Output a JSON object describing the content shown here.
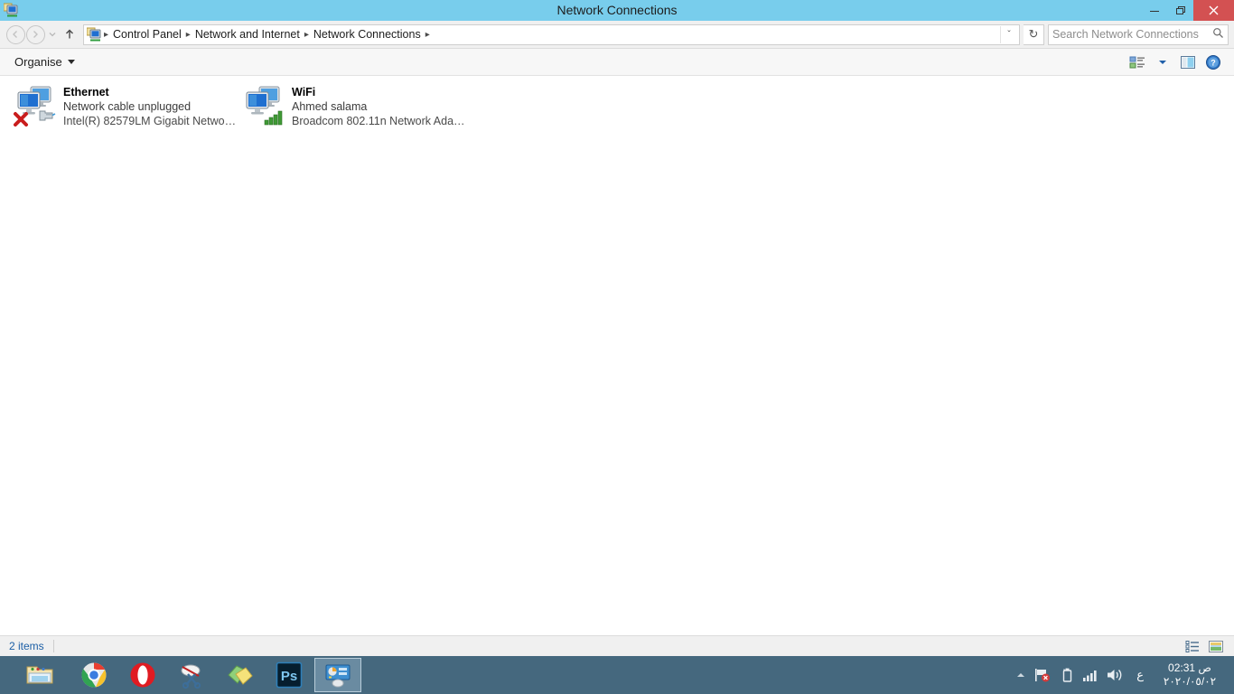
{
  "window": {
    "title": "Network Connections",
    "icon": "network-connections-icon",
    "controls": {
      "minimize": "minimize-button",
      "restore": "restore-button",
      "close": "close-button"
    }
  },
  "navbar": {
    "back": "back-button",
    "forward": "forward-button",
    "recent": "recent-locations-button",
    "up": "up-button",
    "breadcrumb": [
      "Control Panel",
      "Network and Internet",
      "Network Connections"
    ],
    "separator": "▸",
    "dropdown_chevron": "ˇ",
    "refresh": "↻",
    "search": {
      "placeholder": "Search Network Connections",
      "icon": "search-icon"
    }
  },
  "toolbar": {
    "organise_label": "Organise",
    "icons": {
      "view_options": "view-options-icon",
      "view_dropdown": "chevron-down-icon",
      "preview_pane": "preview-pane-icon",
      "help": "help-icon"
    }
  },
  "connections": [
    {
      "name": "Ethernet",
      "status": "Network cable unplugged",
      "adapter": "Intel(R) 82579LM Gigabit Network...",
      "icon": "ethernet-disconnected-icon",
      "state": "disconnected"
    },
    {
      "name": "WiFi",
      "status": "Ahmed salama",
      "adapter": "Broadcom 802.11n Network Adap...",
      "icon": "wifi-connected-icon",
      "state": "connected"
    }
  ],
  "statusbar": {
    "items_count": "2 items",
    "details_view": "details-view-button",
    "large_icons_view": "large-icons-view-button"
  },
  "taskbar": {
    "items": [
      {
        "name": "file-explorer",
        "label": "File Explorer"
      },
      {
        "name": "google-chrome",
        "label": "Google Chrome"
      },
      {
        "name": "opera",
        "label": "Opera"
      },
      {
        "name": "snipping-tool",
        "label": "Snipping Tool"
      },
      {
        "name": "sticky-notes",
        "label": "Sticky Notes"
      },
      {
        "name": "photoshop",
        "label": "Ps"
      },
      {
        "name": "control-panel",
        "label": "Control Panel"
      }
    ],
    "tray": {
      "show_hidden": "show-hidden-icons-icon",
      "network": "network-error-icon",
      "battery": "battery-icon",
      "signal": "signal-icon",
      "volume": "volume-icon",
      "language": "ع",
      "time": "02:31 ص",
      "date": "٢٠٢٠/٠٥/٠٢"
    }
  },
  "colors": {
    "titlebar": "#78cdec",
    "close_button": "#d35152",
    "taskbar": "#45687e",
    "status_text": "#1c5fa6"
  }
}
